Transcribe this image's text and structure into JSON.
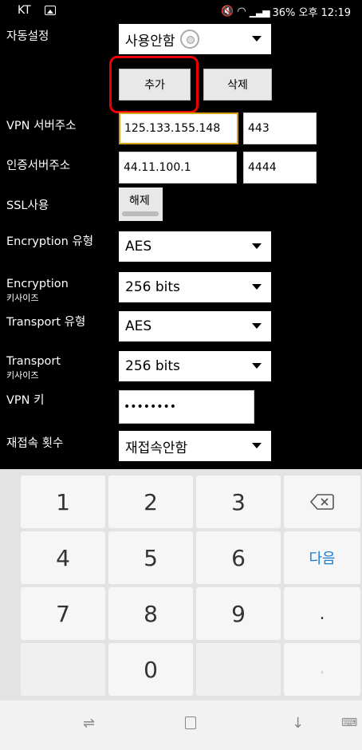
{
  "status": {
    "carrier": "KT",
    "right_text": "36% 오후 12:19"
  },
  "form": {
    "auto_label": "자동설정",
    "auto_value": "사용안함",
    "add_button": "추가",
    "delete_button": "삭제",
    "vpn_server_label": "VPN 서버주소",
    "vpn_server_ip": "125.133.155.148",
    "vpn_server_port": "443",
    "auth_server_label": "인증서버주소",
    "auth_server_ip": "44.11.100.1",
    "auth_server_port": "4444",
    "ssl_label": "SSL사용",
    "ssl_toggle": "해제",
    "enc_type_label": "Encryption 유형",
    "enc_type_value": "AES",
    "enc_key_label_1": "Encryption",
    "enc_key_label_2": "키사이즈",
    "enc_key_value": "256 bits",
    "trans_type_label": "Transport 유형",
    "trans_type_value": "AES",
    "trans_key_label_1": "Transport",
    "trans_key_label_2": "키사이즈",
    "trans_key_value": "256 bits",
    "vpn_key_label": "VPN 키",
    "vpn_key_value": "••••••••",
    "reconnect_label": "재접속 횟수",
    "reconnect_value": "재접속안함"
  },
  "keypad": {
    "k1": "1",
    "k2": "2",
    "k3": "3",
    "k4": "4",
    "k5": "5",
    "k6": "6",
    "k7": "7",
    "k8": "8",
    "k9": "9",
    "k0": "0",
    "dot": ".",
    "comma": ",",
    "next": "다음"
  }
}
